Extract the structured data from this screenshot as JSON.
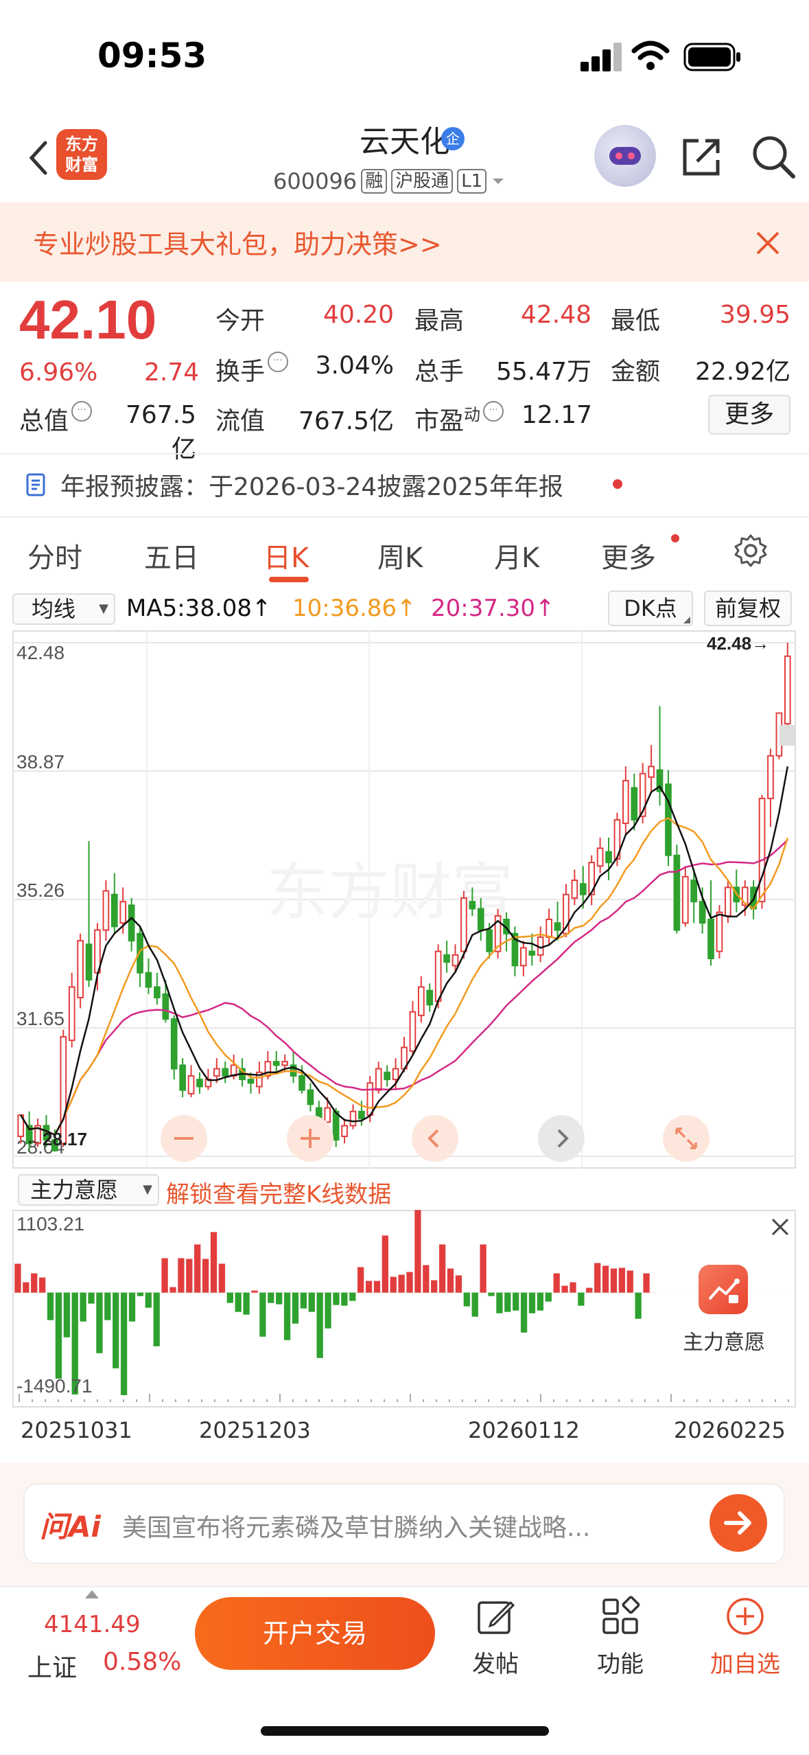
{
  "status_bar": {
    "time": "09:53"
  },
  "header": {
    "app_logo": "东方\n财富",
    "stock_name": "云天化",
    "badge": "企",
    "stock_code": "600096",
    "tags": [
      "融",
      "沪股通",
      "L1"
    ]
  },
  "promo": {
    "text": "专业炒股工具大礼包，助力决策>>"
  },
  "quote": {
    "price": "42.10",
    "change_pct": "6.96%",
    "change_amt": "2.74",
    "items": [
      {
        "label": "今开",
        "value": "40.20"
      },
      {
        "label": "最高",
        "value": "42.48"
      },
      {
        "label": "最低",
        "value": "39.95"
      },
      {
        "label": "换手",
        "value": "3.04%"
      },
      {
        "label": "总手",
        "value": "55.47万"
      },
      {
        "label": "金额",
        "value": "22.92亿"
      },
      {
        "label": "总值",
        "value": "767.5亿"
      },
      {
        "label": "流值",
        "value": "767.5亿"
      },
      {
        "label": "市盈",
        "label_sup": "动",
        "value": "12.17"
      }
    ],
    "more_label": "更多"
  },
  "notice": {
    "text": "年报预披露：于2026-03-24披露2025年年报"
  },
  "tabs": [
    "分时",
    "五日",
    "日K",
    "周K",
    "月K",
    "更多"
  ],
  "active_tab": "日K",
  "ma_bar": {
    "select": "均线",
    "ma5": "MA5:38.08↑",
    "ma10": "10:36.86↑",
    "ma20": "20:37.30↑",
    "dk_button": "DK点",
    "fq_button": "前复权"
  },
  "colors": {
    "up": "#e23d3d",
    "down": "#2ea12e",
    "ma5": "#111111",
    "ma10": "#f29a1e",
    "ma20": "#d42785",
    "accent": "#e8502e"
  },
  "chart_data": [
    {
      "type": "candlestick",
      "y_ticks": [
        "42.48",
        "38.87",
        "35.26",
        "31.65",
        "28.04"
      ],
      "ylim": [
        28.04,
        42.48
      ],
      "max_label": "42.48→",
      "min_label": "←28.17",
      "watermark": "东方财富",
      "candles": [
        [
          28.6,
          29.2,
          28.4,
          28.8
        ],
        [
          28.9,
          28.4,
          28.2,
          29.3
        ],
        [
          28.4,
          28.9,
          28.3,
          29.1
        ],
        [
          28.9,
          28.5,
          28.3,
          29.2
        ],
        [
          28.5,
          28.2,
          28.17,
          28.8
        ],
        [
          28.4,
          31.4,
          28.3,
          31.6
        ],
        [
          31.3,
          32.8,
          31.1,
          33.2
        ],
        [
          32.5,
          34.1,
          32.2,
          34.3
        ],
        [
          34.0,
          33.0,
          32.8,
          36.9
        ],
        [
          33.2,
          34.4,
          32.7,
          34.6
        ],
        [
          34.4,
          35.5,
          34.1,
          35.8
        ],
        [
          35.4,
          34.5,
          34.3,
          36.0
        ],
        [
          34.6,
          35.2,
          34.3,
          35.6
        ],
        [
          35.1,
          34.1,
          33.8,
          35.3
        ],
        [
          34.3,
          33.2,
          32.8,
          34.5
        ],
        [
          33.2,
          32.8,
          32.6,
          33.6
        ],
        [
          32.8,
          32.5,
          32.3,
          33.2
        ],
        [
          32.6,
          31.9,
          31.8,
          33.0
        ],
        [
          31.9,
          30.5,
          30.2,
          32.0
        ],
        [
          30.6,
          29.9,
          29.7,
          30.8
        ],
        [
          29.8,
          30.3,
          29.7,
          30.6
        ],
        [
          30.2,
          30.0,
          29.8,
          30.4
        ],
        [
          30.0,
          30.2,
          29.9,
          30.5
        ],
        [
          30.3,
          30.5,
          30.1,
          30.8
        ],
        [
          30.5,
          30.3,
          30.1,
          30.7
        ],
        [
          30.3,
          30.6,
          30.2,
          30.9
        ],
        [
          30.5,
          30.2,
          30.0,
          30.8
        ],
        [
          30.2,
          30.1,
          29.8,
          30.4
        ],
        [
          30.0,
          30.4,
          29.8,
          30.7
        ],
        [
          30.3,
          30.7,
          30.2,
          31.0
        ],
        [
          30.7,
          30.6,
          30.4,
          31.0
        ],
        [
          30.6,
          30.7,
          30.4,
          30.9
        ],
        [
          30.6,
          30.3,
          30.1,
          31.0
        ],
        [
          30.3,
          29.9,
          29.8,
          30.6
        ],
        [
          29.9,
          29.5,
          29.3,
          30.1
        ],
        [
          29.4,
          29.0,
          28.8,
          29.6
        ],
        [
          29.0,
          29.4,
          28.9,
          29.7
        ],
        [
          29.3,
          28.5,
          28.3,
          29.4
        ],
        [
          28.6,
          28.9,
          28.4,
          29.1
        ],
        [
          28.9,
          29.3,
          28.8,
          29.5
        ],
        [
          29.3,
          29.1,
          28.9,
          29.6
        ],
        [
          29.2,
          30.1,
          29.0,
          30.3
        ],
        [
          29.9,
          30.5,
          29.8,
          30.7
        ],
        [
          30.4,
          30.2,
          30.0,
          30.6
        ],
        [
          30.2,
          30.5,
          29.9,
          30.8
        ],
        [
          30.5,
          31.1,
          30.4,
          31.4
        ],
        [
          31.0,
          32.1,
          30.9,
          32.4
        ],
        [
          32.0,
          32.8,
          31.8,
          33.1
        ],
        [
          32.7,
          32.3,
          32.1,
          32.9
        ],
        [
          32.4,
          33.8,
          32.2,
          34.0
        ],
        [
          33.7,
          33.5,
          33.2,
          34.1
        ],
        [
          33.4,
          33.7,
          33.2,
          34.0
        ],
        [
          33.8,
          35.3,
          33.6,
          35.5
        ],
        [
          35.2,
          35.0,
          34.8,
          35.6
        ],
        [
          35.0,
          34.4,
          34.1,
          35.3
        ],
        [
          34.4,
          33.8,
          33.6,
          34.6
        ],
        [
          33.8,
          34.8,
          33.6,
          35.0
        ],
        [
          34.7,
          34.3,
          33.8,
          34.9
        ],
        [
          34.3,
          33.4,
          33.1,
          34.5
        ],
        [
          33.4,
          33.9,
          33.1,
          34.1
        ],
        [
          33.8,
          33.7,
          33.4,
          34.3
        ],
        [
          33.7,
          34.2,
          33.5,
          34.5
        ],
        [
          34.2,
          34.7,
          34.0,
          35.0
        ],
        [
          34.6,
          34.4,
          34.1,
          35.2
        ],
        [
          34.3,
          35.4,
          34.2,
          35.7
        ],
        [
          35.3,
          35.8,
          35.1,
          36.1
        ],
        [
          35.7,
          35.4,
          35.0,
          36.2
        ],
        [
          35.4,
          36.3,
          35.1,
          36.5
        ],
        [
          36.2,
          36.7,
          36.0,
          37.0
        ],
        [
          36.6,
          36.3,
          35.8,
          37.0
        ],
        [
          36.4,
          37.5,
          36.2,
          37.7
        ],
        [
          37.4,
          38.6,
          37.1,
          39.0
        ],
        [
          38.4,
          37.5,
          37.2,
          38.8
        ],
        [
          37.6,
          38.8,
          37.4,
          39.1
        ],
        [
          38.7,
          39.0,
          38.3,
          39.6
        ],
        [
          38.9,
          38.3,
          37.9,
          40.7
        ],
        [
          38.5,
          36.5,
          36.2,
          38.9
        ],
        [
          36.5,
          34.4,
          34.3,
          36.8
        ],
        [
          34.6,
          35.9,
          34.5,
          36.2
        ],
        [
          35.8,
          35.2,
          34.6,
          36.1
        ],
        [
          35.2,
          34.6,
          34.3,
          35.6
        ],
        [
          34.7,
          33.6,
          33.4,
          35.8
        ],
        [
          33.8,
          34.9,
          33.6,
          35.1
        ],
        [
          34.8,
          35.6,
          34.6,
          35.8
        ],
        [
          35.6,
          35.2,
          34.9,
          36.1
        ],
        [
          35.1,
          35.6,
          34.8,
          35.8
        ],
        [
          35.6,
          35.0,
          34.7,
          35.8
        ],
        [
          35.2,
          38.1,
          35.0,
          38.2
        ],
        [
          38.1,
          39.3,
          37.3,
          39.5
        ],
        [
          39.3,
          40.5,
          39.2,
          40.5
        ],
        [
          40.2,
          42.1,
          39.95,
          42.48
        ]
      ],
      "ma_series": [
        "MA5",
        "MA10",
        "MA20"
      ]
    },
    {
      "type": "bar",
      "name": "主力意愿",
      "y_ticks": [
        "1103.21",
        "-1490.71"
      ],
      "ylim": [
        -1490.71,
        1103.21
      ],
      "values": [
        420,
        150,
        280,
        220,
        -400,
        -1250,
        -650,
        -1480,
        -420,
        -160,
        -880,
        -400,
        -1100,
        -1490,
        -420,
        -50,
        -220,
        -780,
        500,
        80,
        500,
        490,
        700,
        490,
        880,
        420,
        -150,
        -280,
        -320,
        30,
        -640,
        -150,
        -170,
        -690,
        -450,
        -230,
        -280,
        -950,
        -520,
        -180,
        -190,
        -120,
        370,
        170,
        170,
        830,
        230,
        260,
        300,
        1200,
        400,
        180,
        700,
        350,
        250,
        -200,
        -350,
        700,
        -50,
        -300,
        -280,
        -260,
        -580,
        -300,
        -260,
        -130,
        280,
        100,
        150,
        -190,
        70,
        430,
        390,
        350,
        360,
        320,
        -380,
        280
      ],
      "date_labels": [
        "20251031",
        "20251203",
        "20260112",
        "20260225"
      ]
    }
  ],
  "indicator": {
    "select": "主力意愿",
    "unlock_link": "解锁查看完整K线数据",
    "card_label": "主力意愿"
  },
  "ai_bar": {
    "logo": "问Ai",
    "placeholder": "美国宣布将元素磷及草甘膦纳入关键战略..."
  },
  "bottom_nav": {
    "index_value": "4141.49",
    "index_name": "上证",
    "index_pct": "0.58%",
    "trade_button": "开户交易",
    "items": [
      {
        "label": "发帖",
        "icon": "compose-icon"
      },
      {
        "label": "功能",
        "icon": "grid-icon"
      },
      {
        "label": "加自选",
        "icon": "plus-circle-icon"
      }
    ]
  }
}
